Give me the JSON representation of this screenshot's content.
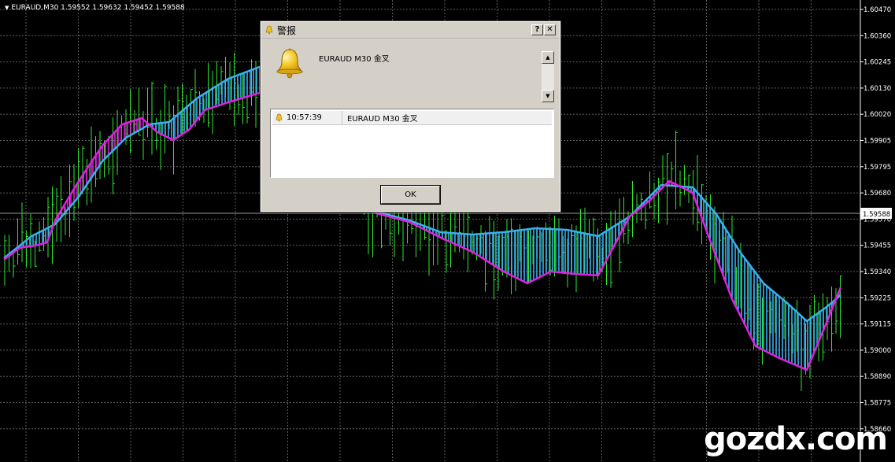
{
  "chart": {
    "symbol_header": "EURAUD,M30  1.59552 1.59632 1.59452 1.59588",
    "current_price": "1.59588",
    "price_scale": [
      "1.60470",
      "1.60360",
      "1.60245",
      "1.60130",
      "1.60020",
      "1.59905",
      "1.59795",
      "1.59680",
      "1.59570",
      "1.59455",
      "1.59340",
      "1.59225",
      "1.59115",
      "1.59000",
      "1.58890",
      "1.58775",
      "1.58660"
    ],
    "colors": {
      "background": "#000000",
      "grid": "#5c5c5c",
      "bars": "#2ee62e",
      "fast_line": "#e020e0",
      "slow_line": "#3ab0ef",
      "axis_text": "#ffffff"
    }
  },
  "dialog": {
    "title": "警报",
    "help_button": "?",
    "close_button": "✕",
    "message": "EURAUD M30 金叉",
    "list": [
      {
        "time": "10:57:39",
        "message": "EURAUD M30 金叉"
      }
    ],
    "ok_label": "OK",
    "icon": "bell-icon"
  },
  "watermark": "gozdx.com"
}
